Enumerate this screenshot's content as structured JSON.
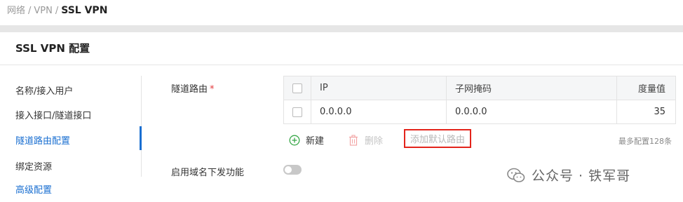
{
  "breadcrumb": {
    "items": [
      "网络",
      "VPN"
    ],
    "separator": "/",
    "current": "SSL VPN"
  },
  "panel": {
    "title": "SSL VPN 配置"
  },
  "nav": {
    "items": [
      {
        "label": "名称/接入用户"
      },
      {
        "label": "接入接口/隧道接口"
      },
      {
        "label": "隧道路由配置",
        "active": true
      },
      {
        "label": "绑定资源"
      },
      {
        "label": "高级配置"
      }
    ]
  },
  "form": {
    "tunnel_route_label": "隧道路由",
    "required_mark": "*",
    "domain_push_label": "启用域名下发功能",
    "domain_push_enabled": false
  },
  "table": {
    "headers": {
      "ip": "IP",
      "mask": "子网掩码",
      "metric": "度量值"
    },
    "rows": [
      {
        "ip": "0.0.0.0",
        "mask": "0.0.0.0",
        "metric": "35"
      }
    ]
  },
  "toolbar": {
    "new_label": "新建",
    "delete_label": "删除",
    "add_default_label": "添加默认路由",
    "max_note": "最多配置128条"
  },
  "watermark": {
    "text": "公众号 · 铁军哥"
  },
  "colors": {
    "accent": "#1a6fd1",
    "highlight_box": "#e3241b",
    "new_icon": "#3aa84a",
    "delete_icon": "#f2a6a6"
  }
}
